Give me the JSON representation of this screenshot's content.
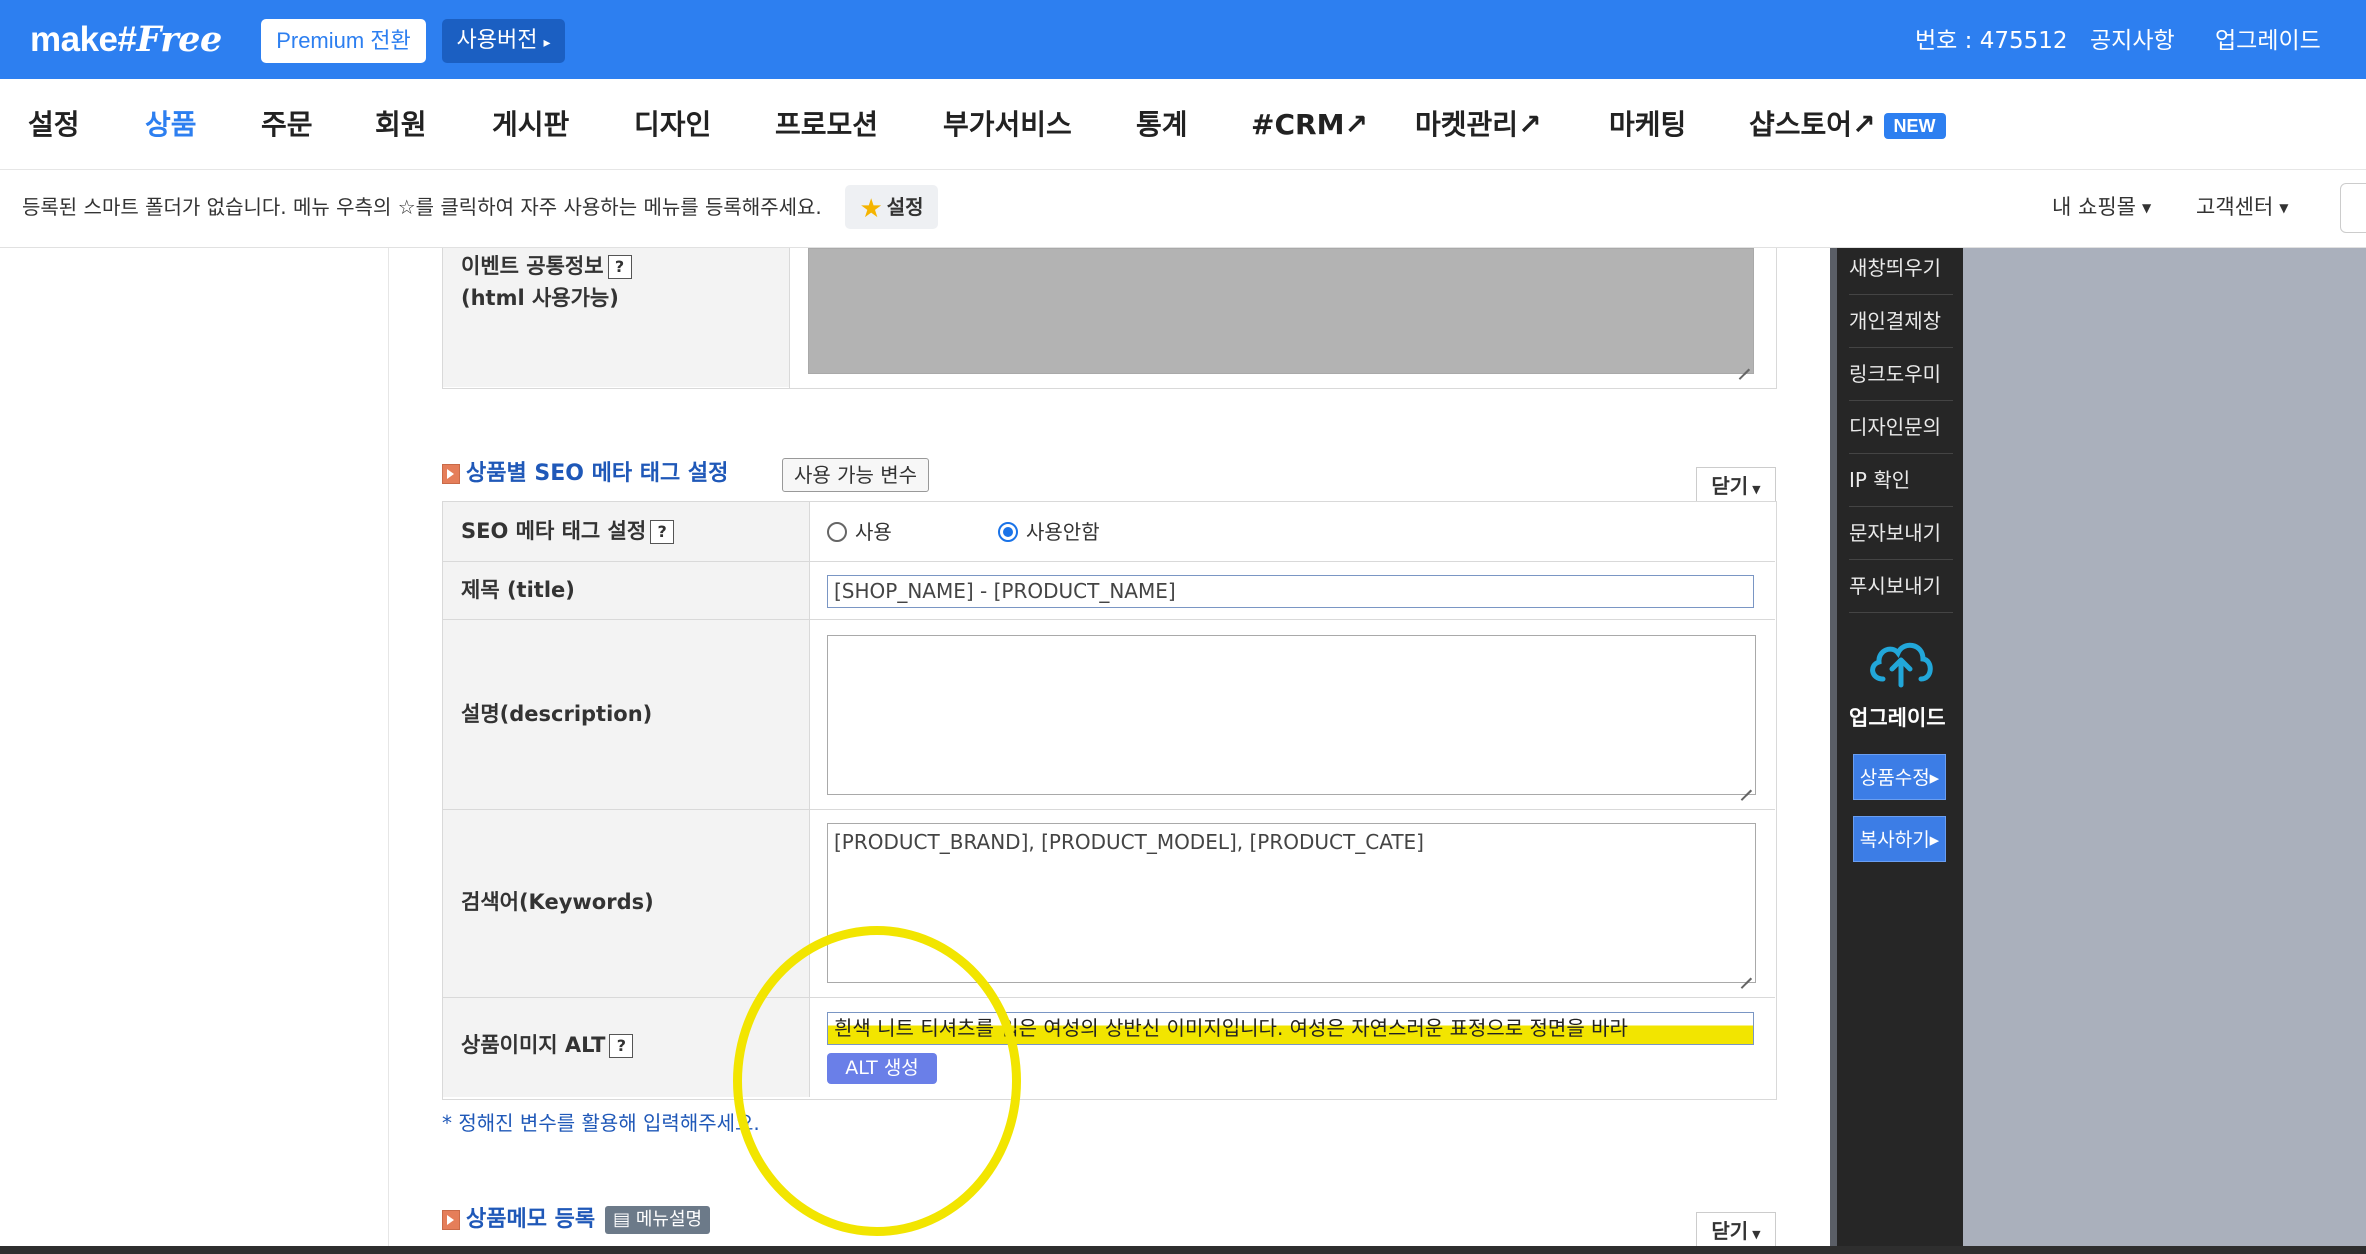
{
  "brand": {
    "logo_make": "make",
    "logo_hash": "#",
    "logo_free": "Free"
  },
  "topbar": {
    "premium_button": "Premium 전환",
    "version_button": "사용버전",
    "version_arrow": "▸",
    "number_label": "번호 : 475512",
    "notice": "공지사항",
    "upgrade": "업그레이드"
  },
  "nav": {
    "items": [
      "설정",
      "상품",
      "주문",
      "회원",
      "게시판",
      "디자인",
      "프로모션",
      "부가서비스",
      "통계",
      "#CRM↗",
      "마켓관리↗",
      "마케팅",
      "샵스토어↗"
    ],
    "active": "상품",
    "new_badge": "NEW"
  },
  "subbar": {
    "message": "등록된 스마트 폴더가 없습니다. 메뉴 우측의 ☆를 클릭하여 자주 사용하는 메뉴를 등록해주세요.",
    "setting_button": "설정",
    "my_shop": "내 쇼핑몰",
    "customer_center": "고객센터"
  },
  "event_section": {
    "label_line1": "이벤트 공통정보",
    "label_line2": "(html 사용가능)"
  },
  "seo_section": {
    "title": "상품별 SEO 메타 태그 설정",
    "variables_button": "사용 가능 변수",
    "close_button": "닫기",
    "rows": {
      "meta_setting": {
        "label": "SEO 메타 태그 설정",
        "option_use": "사용",
        "option_not_use": "사용안함",
        "selected": "사용안함"
      },
      "title": {
        "label": "제목 (title)",
        "value": "[SHOP_NAME] - [PRODUCT_NAME]"
      },
      "description": {
        "label": "설명(description)",
        "value": ""
      },
      "keywords": {
        "label": "검색어(Keywords)",
        "value": "[PRODUCT_BRAND], [PRODUCT_MODEL], [PRODUCT_CATE]"
      },
      "image_alt": {
        "label": "상품이미지 ALT",
        "value": "흰색 니트 티셔츠를 입은 여성의 상반신 이미지입니다. 여성은 자연스러운 표정으로 정면을 바라",
        "generate_button": "ALT 생성"
      }
    },
    "note": "* 정해진 변수를 활용해 입력해주세요."
  },
  "memo_section": {
    "title": "상품메모 등록",
    "manual_button": "메뉴설명",
    "close_button": "닫기"
  },
  "sidebar": {
    "items": [
      "새창띄우기",
      "개인결제창",
      "링크도우미",
      "디자인문의",
      "IP 확인",
      "문자보내기",
      "푸시보내기"
    ],
    "upgrade_label": "업그레이드",
    "edit_button": "상품수정▸",
    "copy_button": "복사하기▸"
  },
  "colors": {
    "brand_blue": "#2d7ff0",
    "highlight_yellow": "#f2e500",
    "sidebar_bg": "#262626",
    "alt_button": "#6a7fe8"
  },
  "icons": [
    "star-icon",
    "section-arrow-icon",
    "question-icon",
    "cloud-upload-icon",
    "caret-down-icon",
    "resize-handle-icon"
  ]
}
